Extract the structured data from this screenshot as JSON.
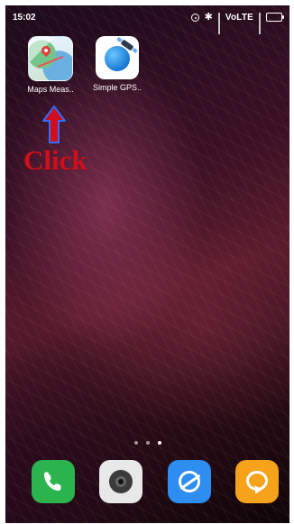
{
  "status_bar": {
    "time": "15:02",
    "network": "VoLTE"
  },
  "apps": [
    {
      "label": "Maps Meas..",
      "icon": "map-measurement-icon"
    },
    {
      "label": "Simple GPS..",
      "icon": "gps-satellite-icon"
    }
  ],
  "annotation": {
    "text": "Click",
    "color": "#d10f1c",
    "arrow_color": "#2f6cff"
  },
  "page_indicator": {
    "pages": 3,
    "active_page": 3
  },
  "dock": [
    {
      "icon": "phone-icon",
      "color": "#2bb34e"
    },
    {
      "icon": "camera-icon",
      "color": "#e8e8e8"
    },
    {
      "icon": "browser-icon",
      "color": "#2d8df0"
    },
    {
      "icon": "messages-icon",
      "color": "#f6a21a"
    }
  ]
}
